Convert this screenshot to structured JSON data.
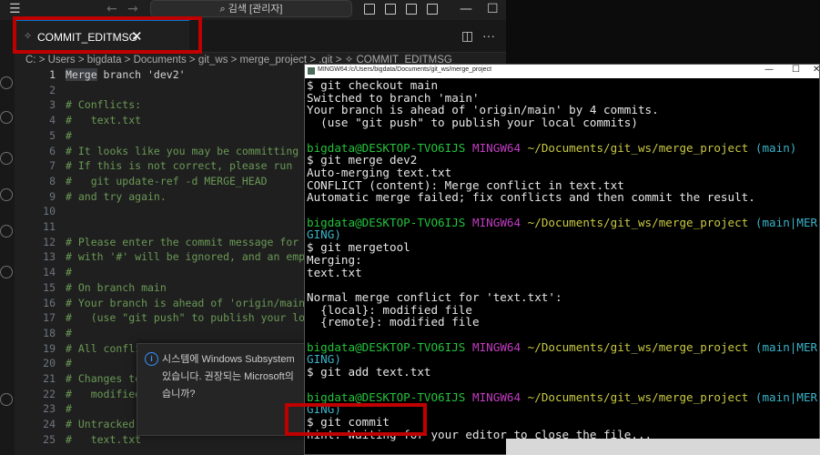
{
  "titlebar": {
    "search_placeholder": "⌕ 김색 [관리자]"
  },
  "editor": {
    "tab_label": "COMMIT_EDITMSG",
    "close_glyph": "✕",
    "split_glyph": "◫",
    "more_glyph": "···",
    "breadcrumb": "C: > Users > bigdata > Documents > git_ws > merge_project > .git > ✧ COMMIT_EDITMSG",
    "lines": [
      {
        "n": "1",
        "text": "Merge branch 'dev2'"
      },
      {
        "n": "2",
        "text": ""
      },
      {
        "n": "3",
        "text": "# Conflicts:"
      },
      {
        "n": "4",
        "text": "#   text.txt"
      },
      {
        "n": "5",
        "text": "#"
      },
      {
        "n": "6",
        "text": "# It looks like you may be committing a"
      },
      {
        "n": "7",
        "text": "# If this is not correct, please run"
      },
      {
        "n": "8",
        "text": "#   git update-ref -d MERGE_HEAD"
      },
      {
        "n": "9",
        "text": "# and try again."
      },
      {
        "n": "10",
        "text": ""
      },
      {
        "n": "11",
        "text": ""
      },
      {
        "n": "12",
        "text": "# Please enter the commit message for y"
      },
      {
        "n": "13",
        "text": "# with '#' will be ignored, and an empt"
      },
      {
        "n": "14",
        "text": "#"
      },
      {
        "n": "15",
        "text": "# On branch main"
      },
      {
        "n": "16",
        "text": "# Your branch is ahead of 'origin/main'"
      },
      {
        "n": "17",
        "text": "#   (use \"git push\" to publish your loc"
      },
      {
        "n": "18",
        "text": "#"
      },
      {
        "n": "19",
        "text": "# All confli"
      },
      {
        "n": "20",
        "text": "#"
      },
      {
        "n": "21",
        "text": "# Changes to"
      },
      {
        "n": "22",
        "text": "#   modified"
      },
      {
        "n": "23",
        "text": "#"
      },
      {
        "n": "24",
        "text": "# Untracked"
      },
      {
        "n": "25",
        "text": "#   text.txt"
      }
    ]
  },
  "notification": {
    "icon": "i",
    "text": "시스템에 Windows Subsystem\n있습니다. 권장되는 Microsoft의\n습니까?"
  },
  "terminal": {
    "title": "MINGW64:/c/Users/bigdata/Documents/git_ws/merge_project",
    "min_glyph": "—",
    "max_glyph": "☐",
    "close_glyph": "✕",
    "user": "bigdata@DESKTOP-TVO6IJS",
    "env": "MINGW64",
    "path": "~/Documents/git_ws/merge_project",
    "branch_main": "(main)",
    "branch_merging_a": "(main|MER",
    "branch_merging_b": "GING)",
    "lines_1": [
      "$ git checkout main",
      "Switched to branch 'main'",
      "Your branch is ahead of 'origin/main' by 4 commits.",
      "  (use \"git push\" to publish your local commits)"
    ],
    "lines_2": [
      "$ git merge dev2",
      "Auto-merging text.txt",
      "CONFLICT (content): Merge conflict in text.txt",
      "Automatic merge failed; fix conflicts and then commit the result."
    ],
    "lines_3": [
      "$ git mergetool",
      "Merging:",
      "text.txt",
      "",
      "Normal merge conflict for 'text.txt':",
      "  {local}: modified file",
      "  {remote}: modified file"
    ],
    "lines_4": [
      "$ git add text.txt"
    ],
    "commit_cmd": "$ git commit",
    "hint": "hint: Waiting for your editor to close the file..."
  }
}
